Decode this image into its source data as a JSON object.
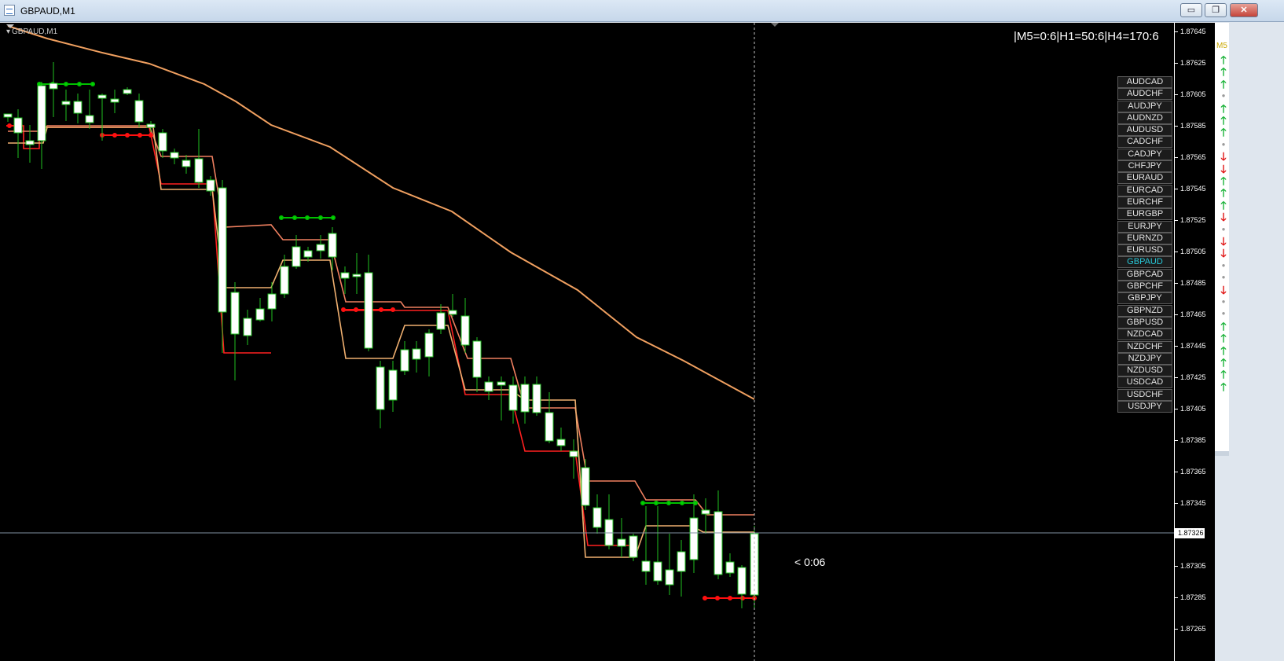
{
  "window": {
    "title": "GBPAUD,M1",
    "buttons": {
      "minimize": "▭",
      "maximize": "❐",
      "close": "✕"
    }
  },
  "chart": {
    "symbol_label": "GBPAUD,M1",
    "mtf_info": "|M5=0:6|H1=50:6|H4=170:6",
    "countdown": "< 0:06",
    "current_price": "1.87326",
    "price_ticks": [
      "1.87645",
      "1.87625",
      "1.87605",
      "1.87585",
      "1.87565",
      "1.87545",
      "1.87525",
      "1.87505",
      "1.87485",
      "1.87465",
      "1.87445",
      "1.87425",
      "1.87405",
      "1.87385",
      "1.87365",
      "1.87345",
      "1.87305",
      "1.87285",
      "1.87265"
    ],
    "colors": {
      "background": "#000000",
      "bull_body": "#ffffff",
      "wick": "#20c020",
      "ma": "#f0a060",
      "channel_upper": "#f08060",
      "channel_lower": "#f0b070",
      "signal_green": "#00e000",
      "signal_red": "#ff1010"
    }
  },
  "pairs": [
    {
      "label": "AUDCAD",
      "active": false
    },
    {
      "label": "AUDCHF",
      "active": false
    },
    {
      "label": "AUDJPY",
      "active": false
    },
    {
      "label": "AUDNZD",
      "active": false
    },
    {
      "label": "AUDUSD",
      "active": false
    },
    {
      "label": "CADCHF",
      "active": false
    },
    {
      "label": "CADJPY",
      "active": false
    },
    {
      "label": "CHFJPY",
      "active": false
    },
    {
      "label": "EURAUD",
      "active": false
    },
    {
      "label": "EURCAD",
      "active": false
    },
    {
      "label": "EURCHF",
      "active": false
    },
    {
      "label": "EURGBP",
      "active": false
    },
    {
      "label": "EURJPY",
      "active": false
    },
    {
      "label": "EURNZD",
      "active": false
    },
    {
      "label": "EURUSD",
      "active": false
    },
    {
      "label": "GBPAUD",
      "active": true
    },
    {
      "label": "GBPCAD",
      "active": false
    },
    {
      "label": "GBPCHF",
      "active": false
    },
    {
      "label": "GBPJPY",
      "active": false
    },
    {
      "label": "GBPNZD",
      "active": false
    },
    {
      "label": "GBPUSD",
      "active": false
    },
    {
      "label": "NZDCAD",
      "active": false
    },
    {
      "label": "NZDCHF",
      "active": false
    },
    {
      "label": "NZDJPY",
      "active": false
    },
    {
      "label": "NZDUSD",
      "active": false
    },
    {
      "label": "USDCAD",
      "active": false
    },
    {
      "label": "USDCHF",
      "active": false
    },
    {
      "label": "USDJPY",
      "active": false
    }
  ],
  "side_panel": {
    "timeframe": "M5",
    "arrows": [
      "up",
      "up",
      "up",
      "dot",
      "up",
      "up",
      "up",
      "dot",
      "down",
      "down",
      "up",
      "up",
      "up",
      "down",
      "dot",
      "down",
      "down",
      "dot",
      "dot",
      "down",
      "dot",
      "dot",
      "up",
      "up",
      "up",
      "up",
      "up",
      "up"
    ]
  }
}
